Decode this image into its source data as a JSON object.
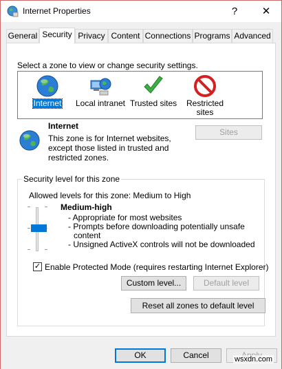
{
  "window": {
    "title": "Internet Properties",
    "help": "?",
    "close": "✕"
  },
  "tabs": [
    "General",
    "Security",
    "Privacy",
    "Content",
    "Connections",
    "Programs",
    "Advanced"
  ],
  "security": {
    "instruction": "Select a zone to view or change security settings.",
    "zones": [
      {
        "label": "Internet",
        "icon": "globe-icon"
      },
      {
        "label": "Local intranet",
        "icon": "intranet-icon"
      },
      {
        "label": "Trusted sites",
        "icon": "checkmark-icon"
      },
      {
        "label_line1": "Restricted",
        "label_line2": "sites",
        "icon": "restricted-icon"
      }
    ],
    "zone_info": {
      "title": "Internet",
      "desc_line1": "This zone is for Internet websites,",
      "desc_line2": "except those listed in trusted and",
      "desc_line3": "restricted zones."
    },
    "sites_button": "Sites",
    "level_group": {
      "title": "Security level for this zone",
      "allowed": "Allowed levels for this zone: Medium to High",
      "level_name": "Medium-high",
      "bullet1": "- Appropriate for most websites",
      "bullet2a": "- Prompts before downloading potentially unsafe",
      "bullet2b": "content",
      "bullet3": "- Unsigned ActiveX controls will not be downloaded",
      "protected_mode": "Enable Protected Mode (requires restarting Internet Explorer)",
      "protected_checked": true,
      "custom_level": "Custom level...",
      "default_level": "Default level"
    },
    "reset_all": "Reset all zones to default level"
  },
  "footer": {
    "ok": "OK",
    "cancel": "Cancel",
    "apply": "Apply"
  },
  "watermark": "wsxdn.com",
  "colors": {
    "accent": "#0078d7",
    "disabled_text": "#a0a0a0"
  }
}
